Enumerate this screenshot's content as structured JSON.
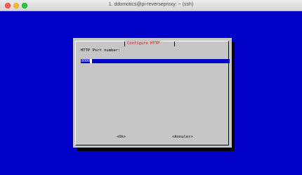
{
  "window": {
    "title": "1. ddomotics@pi-reverseproxy: ~ (ssh)"
  },
  "dialog": {
    "title": "Configure HTTP",
    "prompt": "HTTP Port number:",
    "input_value": "8080",
    "ok_label": "<Ok>",
    "cancel_label": "<Annuler>"
  },
  "colors": {
    "background": "#0000c6",
    "dialog": "#c6c6c6",
    "title": "#c81a1a"
  }
}
